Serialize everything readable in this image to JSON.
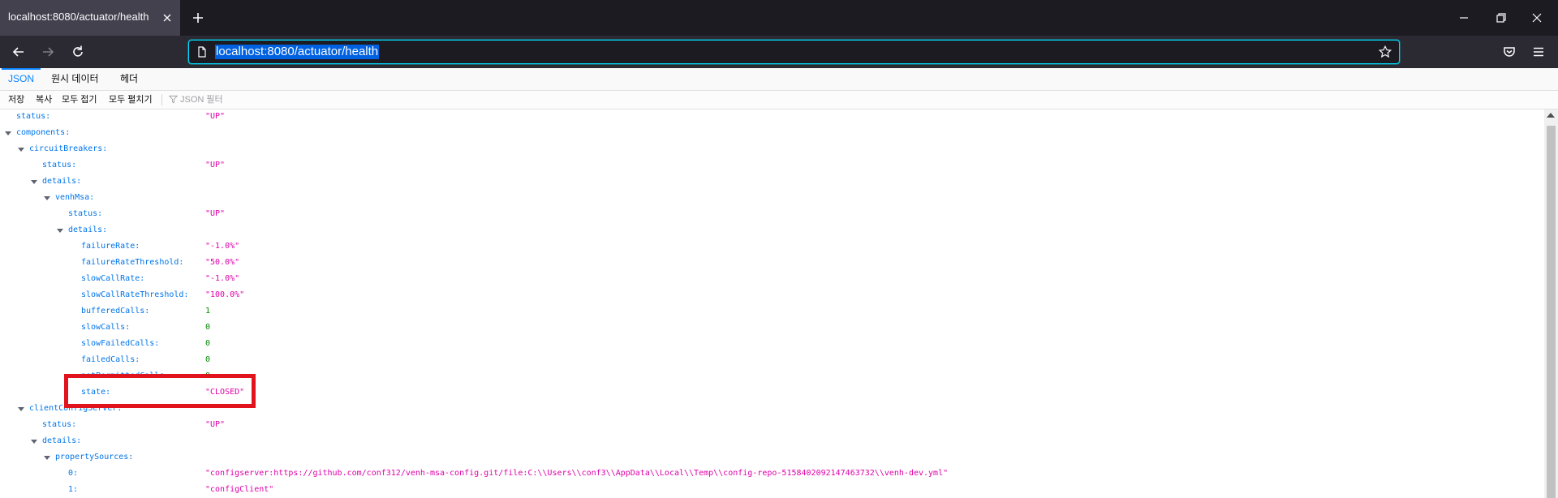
{
  "browser": {
    "tab_title": "localhost:8080/actuator/health",
    "url": "localhost:8080/actuator/health"
  },
  "viewer": {
    "tabs": [
      "JSON",
      "원시 데이터",
      "헤더"
    ],
    "toolbar": {
      "save": "저장",
      "copy": "복사",
      "collapse_all": "모두 접기",
      "expand_all": "모두 펼치기",
      "filter_placeholder": "JSON 필터"
    }
  },
  "tree": [
    {
      "key": "status:",
      "value": "\"UP\"",
      "type": "str",
      "depth": 1,
      "expandable": false
    },
    {
      "key": "components:",
      "value": "",
      "type": "obj",
      "depth": 1,
      "expandable": true
    },
    {
      "key": "circuitBreakers:",
      "value": "",
      "type": "obj",
      "depth": 2,
      "expandable": true
    },
    {
      "key": "status:",
      "value": "\"UP\"",
      "type": "str",
      "depth": 3,
      "expandable": false
    },
    {
      "key": "details:",
      "value": "",
      "type": "obj",
      "depth": 3,
      "expandable": true
    },
    {
      "key": "venhMsa:",
      "value": "",
      "type": "obj",
      "depth": 4,
      "expandable": true
    },
    {
      "key": "status:",
      "value": "\"UP\"",
      "type": "str",
      "depth": 5,
      "expandable": false
    },
    {
      "key": "details:",
      "value": "",
      "type": "obj",
      "depth": 5,
      "expandable": true
    },
    {
      "key": "failureRate:",
      "value": "\"-1.0%\"",
      "type": "str",
      "depth": 6,
      "expandable": false
    },
    {
      "key": "failureRateThreshold:",
      "value": "\"50.0%\"",
      "type": "str",
      "depth": 6,
      "expandable": false
    },
    {
      "key": "slowCallRate:",
      "value": "\"-1.0%\"",
      "type": "str",
      "depth": 6,
      "expandable": false
    },
    {
      "key": "slowCallRateThreshold:",
      "value": "\"100.0%\"",
      "type": "str",
      "depth": 6,
      "expandable": false
    },
    {
      "key": "bufferedCalls:",
      "value": "1",
      "type": "num",
      "depth": 6,
      "expandable": false
    },
    {
      "key": "slowCalls:",
      "value": "0",
      "type": "num",
      "depth": 6,
      "expandable": false
    },
    {
      "key": "slowFailedCalls:",
      "value": "0",
      "type": "num",
      "depth": 6,
      "expandable": false
    },
    {
      "key": "failedCalls:",
      "value": "0",
      "type": "num",
      "depth": 6,
      "expandable": false
    },
    {
      "key": "notPermittedCalls:",
      "value": "0",
      "type": "num",
      "depth": 6,
      "expandable": false
    },
    {
      "key": "state:",
      "value": "\"CLOSED\"",
      "type": "str",
      "depth": 6,
      "expandable": false
    },
    {
      "key": "clientConfigServer:",
      "value": "",
      "type": "obj",
      "depth": 2,
      "expandable": true
    },
    {
      "key": "status:",
      "value": "\"UP\"",
      "type": "str",
      "depth": 3,
      "expandable": false
    },
    {
      "key": "details:",
      "value": "",
      "type": "obj",
      "depth": 3,
      "expandable": true
    },
    {
      "key": "propertySources:",
      "value": "",
      "type": "obj",
      "depth": 4,
      "expandable": true
    },
    {
      "key": "0:",
      "value": "\"configserver:https://github.com/conf312/venh-msa-config.git/file:C:\\\\Users\\\\conf3\\\\AppData\\\\Local\\\\Temp\\\\config-repo-5158402092147463732\\\\venh-dev.yml\"",
      "type": "str",
      "depth": 5,
      "expandable": false
    },
    {
      "key": "1:",
      "value": "\"configClient\"",
      "type": "str",
      "depth": 5,
      "expandable": false
    }
  ]
}
